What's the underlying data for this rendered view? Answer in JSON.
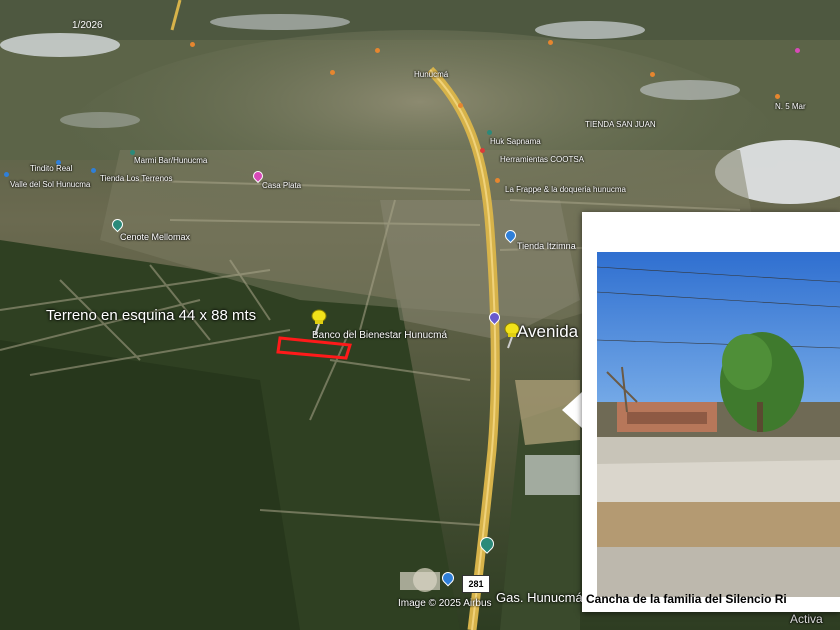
{
  "date_label": "1/2026",
  "labels": {
    "plot": "Terreno en esquina 44 x 88 mts",
    "bank": "Banco del Bienestar Hunucmá",
    "avenida": "Avenida",
    "hunucma": "Gas. Hunucmá",
    "cenote": "Cenote Mellomax",
    "tienda": "Tienda Itzimna",
    "casa": "Casa Plata",
    "tienda_ferr": "Tienda Los Terrenos",
    "marmi": "Marmi Bar/Hunucma",
    "hundpa": "Huk Sapnama",
    "herm": "Herramientas COOTSA",
    "lafrappe": "La Frappe & la doqueria hunucma",
    "vale": "Valle del Sol Hunucma",
    "tinditos": "Tindito Real",
    "ruta": "Hunucmá",
    "chem": "TIENDA SAN JUAN",
    "nn": "N. 5 Mar",
    "copyright": "Image © 2025 Airbus",
    "activate": "Activa",
    "highway": "281"
  },
  "popup": {
    "caption": "Cancha de la familia del Silencio Ri"
  },
  "colors": {
    "plot_outline": "#ff1a1a",
    "pushpin": "#f2e21a",
    "road": "#d7b34a",
    "poi_teal": "#2b8a7a",
    "poi_blue": "#2f7fd8"
  },
  "icons": [
    "yellow-pushpin-icon",
    "map-marker-icon",
    "poi-icon"
  ]
}
